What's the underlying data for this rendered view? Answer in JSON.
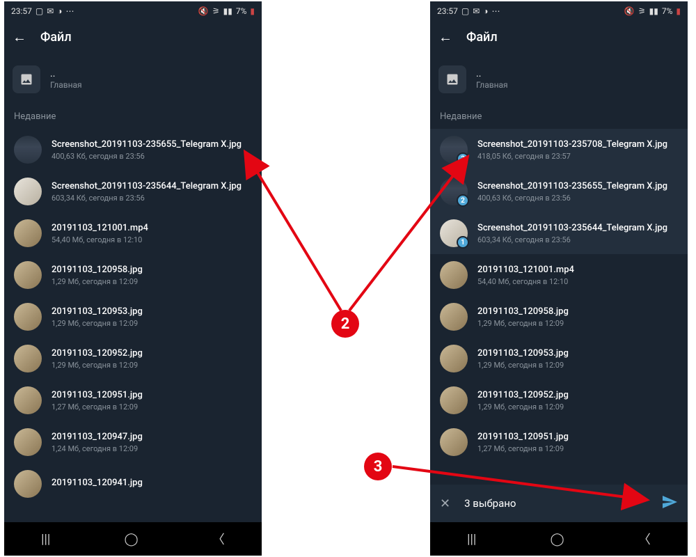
{
  "status": {
    "time": "23:57",
    "battery": "7%"
  },
  "header": {
    "title": "Файл"
  },
  "folder": {
    "dots": "..",
    "home": "Главная"
  },
  "section": "Недавние",
  "left_files": [
    {
      "name": "Screenshot_20191103-235655_Telegram X.jpg",
      "meta": "400,63 Кб, сегодня в 23:56",
      "thumb": "screenshot"
    },
    {
      "name": "Screenshot_20191103-235644_Telegram X.jpg",
      "meta": "603,34 Кб, сегодня в 23:56",
      "thumb": "light"
    },
    {
      "name": "20191103_121001.mp4",
      "meta": "54,40 Мб, сегодня в 12:10",
      "thumb": "photo"
    },
    {
      "name": "20191103_120958.jpg",
      "meta": "1,29 Мб, сегодня в 12:09",
      "thumb": "photo"
    },
    {
      "name": "20191103_120953.jpg",
      "meta": "1,29 Мб, сегодня в 12:09",
      "thumb": "photo"
    },
    {
      "name": "20191103_120952.jpg",
      "meta": "1,29 Мб, сегодня в 12:09",
      "thumb": "photo"
    },
    {
      "name": "20191103_120951.jpg",
      "meta": "1,27 Мб, сегодня в 12:09",
      "thumb": "photo"
    },
    {
      "name": "20191103_120947.jpg",
      "meta": "1,24 Мб, сегодня в 12:09",
      "thumb": "photo"
    },
    {
      "name": "20191103_120941.jpg",
      "meta": "",
      "thumb": "photo"
    }
  ],
  "right_files": [
    {
      "name": "Screenshot_20191103-235708_Telegram X.jpg",
      "meta": "418,05 Кб, сегодня в 23:57",
      "thumb": "screenshot",
      "badge": "3",
      "selected": true
    },
    {
      "name": "Screenshot_20191103-235655_Telegram X.jpg",
      "meta": "400,63 Кб, сегодня в 23:56",
      "thumb": "screenshot",
      "badge": "2",
      "selected": true
    },
    {
      "name": "Screenshot_20191103-235644_Telegram X.jpg",
      "meta": "603,34 Кб, сегодня в 23:56",
      "thumb": "light",
      "badge": "1",
      "selected": true
    },
    {
      "name": "20191103_121001.mp4",
      "meta": "54,40 Мб, сегодня в 12:10",
      "thumb": "photo"
    },
    {
      "name": "20191103_120958.jpg",
      "meta": "1,29 Мб, сегодня в 12:09",
      "thumb": "photo"
    },
    {
      "name": "20191103_120953.jpg",
      "meta": "1,29 Мб, сегодня в 12:09",
      "thumb": "photo"
    },
    {
      "name": "20191103_120952.jpg",
      "meta": "1,29 Мб, сегодня в 12:09",
      "thumb": "photo"
    },
    {
      "name": "20191103_120951.jpg",
      "meta": "1,27 Мб, сегодня в 12:09",
      "thumb": "photo"
    }
  ],
  "selection": {
    "count_label": "3 выбрано"
  },
  "callouts": {
    "two": "2",
    "three": "3"
  }
}
